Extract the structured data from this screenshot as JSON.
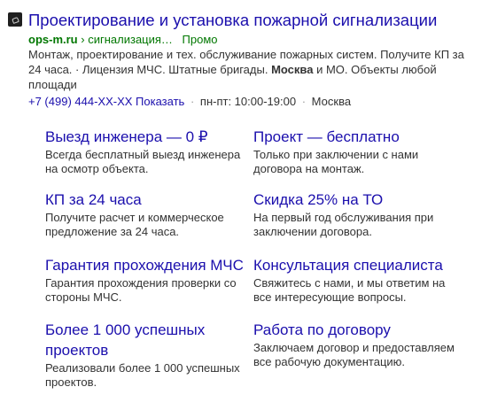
{
  "ad": {
    "title": "Проектирование и установка пожарной сигнализации",
    "path": {
      "domain": "ops-m.ru",
      "separator": "›",
      "crumb": "сигнализация…",
      "badge": "Промо"
    },
    "description": {
      "part1": "Монтаж, проектирование и тех. обслуживание пожарных систем. Получите КП за 24 часа. · Лицензия МЧС. Штатные бригады. ",
      "bold": "Москва",
      "part2": " и МО. Объекты любой площади"
    },
    "contacts": {
      "phone": "+7 (499) 444-ХХ-ХХ Показать",
      "hours": "пн-пт: 10:00-19:00",
      "city": "Москва",
      "separator": "·"
    },
    "sitelinks": [
      {
        "title": "Выезд инженера — 0 ₽",
        "description": "Всегда бесплатный выезд инженера на осмотр объекта."
      },
      {
        "title": "Проект — бесплатно",
        "description": "Только при заключении с нами договора на монтаж."
      },
      {
        "title": "КП за 24 часа",
        "description": "Получите расчет и коммерческое предложение за 24 часа."
      },
      {
        "title": "Скидка 25% на ТО",
        "description": "На первый год обслуживания при заключении договора."
      },
      {
        "title": "Гарантия прохождения МЧС",
        "description": "Гарантия прохождения проверки со стороны МЧС."
      },
      {
        "title": "Консультация специалиста",
        "description": "Свяжитесь с нами, и мы ответим на все интересующие вопросы."
      },
      {
        "title": "Более 1 000 успешных проектов",
        "description": "Реализовали более 1 000 успешных проектов."
      },
      {
        "title": "Работа по договору",
        "description": "Заключаем договор и предоставляем все рабочую документацию."
      }
    ],
    "colors": {
      "link": "#1b0fad",
      "url_green": "#007700",
      "text": "#333333"
    },
    "icon": "site-favicon-icon"
  }
}
